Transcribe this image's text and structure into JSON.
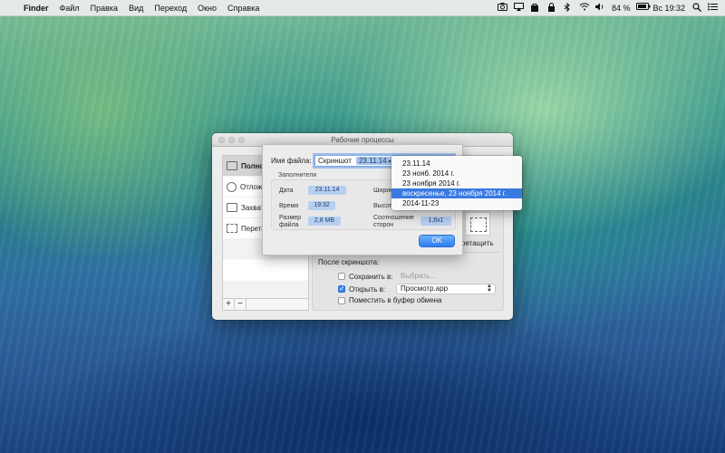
{
  "menubar": {
    "apple": "",
    "app": "Finder",
    "items": [
      "Файл",
      "Правка",
      "Вид",
      "Переход",
      "Окно",
      "Справка"
    ],
    "battery": "84 %",
    "clock": "Вс 19:32"
  },
  "window": {
    "title": "Рабочие процессы",
    "sidebar": {
      "items": [
        "Полноэкранный",
        "Отложенный",
        "Захват окна",
        "Перетащить"
      ],
      "add": "+",
      "remove": "−"
    },
    "drag_label": "ретащить",
    "after_screenshot": {
      "title": "После скриншота:",
      "save_label": "Сохранить в:",
      "save_value": "Выбрать…",
      "open_label": "Открыть в:",
      "open_value": "Просмотр.app",
      "clipboard_label": "Поместить в буфер обмена"
    }
  },
  "sheet": {
    "filename_label": "Имя файла:",
    "filename_text": "Скриншот",
    "filename_token": "23.11.14",
    "placeholders_label": "Заполнители",
    "date_label": "Дата",
    "date_token": "23.11.14",
    "time_label": "Время",
    "time_token": "19:32",
    "size_label": "Размер файла",
    "size_token": "2,8 MB",
    "width_label": "Ширин",
    "height_label": "Высота",
    "ratio_label": "Соотношение сторон",
    "ratio_token": "1,6x1",
    "ok": "OK"
  },
  "dropdown": {
    "options": [
      "23.11.14",
      "23 нояб. 2014 г.",
      "23 ноября 2014 г.",
      "воскресенье, 23 ноября 2014 г.",
      "2014-11-23"
    ],
    "selected_index": 3
  },
  "colors": {
    "accent": "#3a79e0",
    "token": "#a7c4ec"
  }
}
